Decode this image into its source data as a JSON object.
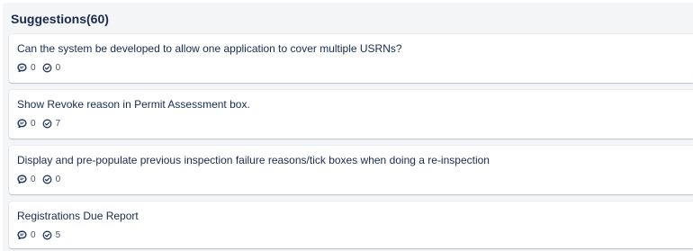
{
  "panel": {
    "title": "Suggestions(60)"
  },
  "suggestions": [
    {
      "title": "Can the system be developed to allow one application to cover multiple USRNs?",
      "comments": "0",
      "votes": "0"
    },
    {
      "title": "Show Revoke reason in Permit Assessment box.",
      "comments": "0",
      "votes": "7"
    },
    {
      "title": "Display and pre-populate previous inspection failure reasons/tick boxes when doing a re-inspection",
      "comments": "0",
      "votes": "0"
    },
    {
      "title": "Registrations Due Report",
      "comments": "0",
      "votes": "5"
    }
  ],
  "icons": {
    "comment": "comment-icon",
    "vote": "check-circle-icon"
  },
  "colors": {
    "panel_background": "#f4f5f7",
    "text": "#172b4d",
    "meta_text": "#42526e"
  }
}
